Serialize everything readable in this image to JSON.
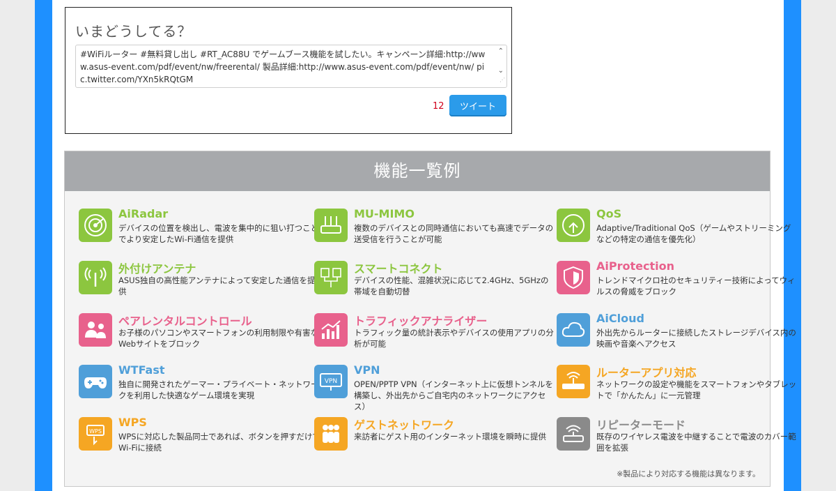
{
  "tweet": {
    "heading": "いまどうしてる？",
    "text": "#WiFiルーター #無料貸し出し #RT_AC88U でゲームブース機能を試したい。キャンペーン詳細:http://www.asus-event.com/pdf/event/nw/freerental/ 製品詳細:http://www.asus-event.com/pdf/event/nw/ pic.twitter.com/YXn5kRQtGM",
    "char_count": "12",
    "button_label": "ツイート"
  },
  "features_panel": {
    "title": "機能一覧例",
    "note": "※製品により対応する機能は異なります。",
    "items": [
      {
        "title": "AiRadar",
        "desc": "デバイスの位置を検出し、電波を集中的に狙い打つことでより安定したWi-Fi通信を提供",
        "color": "#8cc63f",
        "icon": "radar-icon"
      },
      {
        "title": "MU-MIMO",
        "desc": "複数のデバイスとの同時通信においても高速でデータの送受信を行うことが可能",
        "color": "#8cc63f",
        "icon": "router-icon"
      },
      {
        "title": "QoS",
        "desc": "Adaptive/Traditional QoS（ゲームやストリーミングなどの特定の通信を優先化）",
        "color": "#8cc63f",
        "icon": "qos-icon"
      },
      {
        "title": "外付けアンテナ",
        "desc": "ASUS独自の高性能アンテナによって安定した通信を提供",
        "color": "#8cc63f",
        "icon": "antenna-icon"
      },
      {
        "title": "スマートコネクト",
        "desc": "デバイスの性能、混雑状況に応じて2.4GHz、5GHzの帯域を自動切替",
        "color": "#8cc63f",
        "icon": "smart-connect-icon"
      },
      {
        "title": "AiProtection",
        "desc": "トレンドマイクロ社のセキュリティー技術によってウィルスの脅威をブロック",
        "color": "#e8618c",
        "icon": "shield-icon"
      },
      {
        "title": "ペアレンタルコントロール",
        "desc": "お子様のパソコンやスマートフォンの利用制限や有害なWebサイトをブロック",
        "color": "#e8618c",
        "icon": "parental-icon"
      },
      {
        "title": "トラフィックアナライザー",
        "desc": "トラフィック量の統計表示やデバイスの使用アプリの分析が可能",
        "color": "#e8618c",
        "icon": "chart-icon"
      },
      {
        "title": "AiCloud",
        "desc": "外出先からルーターに接続したストレージデバイス内の映画や音楽へアクセス",
        "color": "#4f9fd9",
        "icon": "cloud-icon"
      },
      {
        "title": "WTFast",
        "desc": "独自に開発されたゲーマー・プライベート・ネットワークを利用した快適なゲーム環境を実現",
        "color": "#4f9fd9",
        "icon": "gamepad-icon"
      },
      {
        "title": "VPN",
        "desc": "OPEN/PPTP VPN（インターネット上に仮想トンネルを構築し、外出先からご自宅内のネットワークにアクセス）",
        "color": "#4f9fd9",
        "icon": "vpn-icon"
      },
      {
        "title": "ルーターアプリ対応",
        "desc": "ネットワークの設定や機能をスマートフォンやタブレットで「かんたん」に一元管理",
        "color": "#f5a623",
        "icon": "router-app-icon"
      },
      {
        "title": "WPS",
        "desc": "WPSに対応した製品同士であれば、ボタンを押すだけでWi-Fiに接続",
        "color": "#f5a623",
        "icon": "wps-icon"
      },
      {
        "title": "ゲストネットワーク",
        "desc": "来訪者にゲスト用のインターネット環境を瞬時に提供",
        "color": "#f5a623",
        "icon": "guest-icon"
      },
      {
        "title": "リピーターモード",
        "desc": "既存のワイヤレス電波を中継することで電波のカバー範囲を拡張",
        "color": "#8a8a8a",
        "icon": "repeater-icon"
      }
    ]
  }
}
